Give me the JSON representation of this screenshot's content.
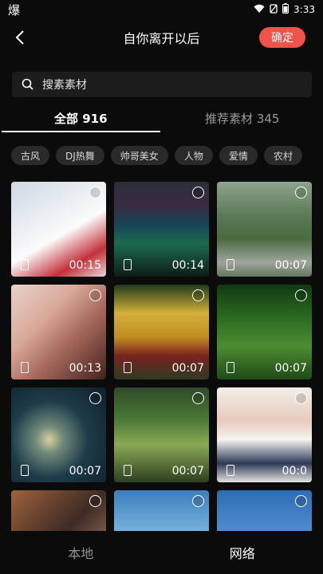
{
  "status_bar": {
    "left_glyph": "爆",
    "time": "3:33",
    "icons": [
      "wifi-icon",
      "no-sim-icon",
      "battery-icon"
    ]
  },
  "header": {
    "back_icon": "chevron-left-icon",
    "title": "自你离开以后",
    "confirm_label": "确定",
    "accent_color": "#f0534a"
  },
  "search": {
    "placeholder": "搜素素材",
    "icon": "search-icon"
  },
  "tabs": [
    {
      "label": "全部 916",
      "active": true
    },
    {
      "label": "推荐素材 345",
      "active": false
    }
  ],
  "chips": [
    "古风",
    "DJ热舞",
    "帅哥美女",
    "人物",
    "爱情",
    "农村"
  ],
  "tiles": [
    {
      "duration": "00:15"
    },
    {
      "duration": "00:14"
    },
    {
      "duration": "00:07"
    },
    {
      "duration": "00:13"
    },
    {
      "duration": "00:07"
    },
    {
      "duration": "00:07"
    },
    {
      "duration": "00:07"
    },
    {
      "duration": "00:07"
    },
    {
      "duration": "00:0"
    },
    {
      "duration": ""
    },
    {
      "duration": ""
    },
    {
      "duration": ""
    }
  ],
  "bottom_tabs": [
    {
      "label": "本地",
      "active": false
    },
    {
      "label": "网络",
      "active": true
    }
  ]
}
